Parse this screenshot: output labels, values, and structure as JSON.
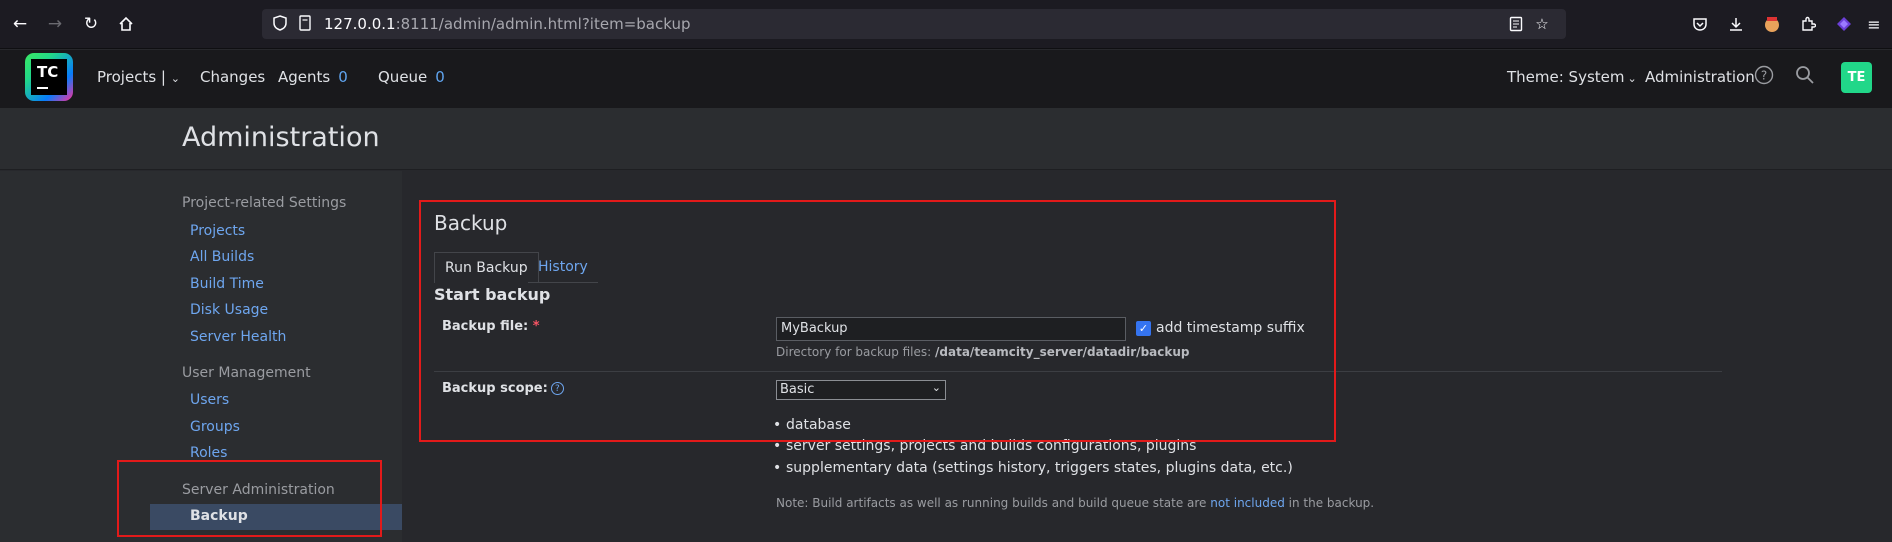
{
  "browser": {
    "url_host": "127.0.0.1",
    "url_rest": ":8111/admin/admin.html?item=backup"
  },
  "header": {
    "logo_text": "TC",
    "projects": "Projects |",
    "changes": "Changes",
    "agents": "Agents",
    "agents_count": "0",
    "queue": "Queue",
    "queue_count": "0",
    "theme": "Theme: System",
    "administration": "Administration",
    "avatar": "TE"
  },
  "page": {
    "title": "Administration"
  },
  "sidebar": {
    "groups": [
      {
        "label": "Project-related Settings"
      },
      {
        "label": "User Management"
      },
      {
        "label": "Server Administration"
      }
    ],
    "items": [
      {
        "label": "Projects"
      },
      {
        "label": "All Builds"
      },
      {
        "label": "Build Time"
      },
      {
        "label": "Disk Usage"
      },
      {
        "label": "Server Health"
      },
      {
        "label": "Users"
      },
      {
        "label": "Groups"
      },
      {
        "label": "Roles"
      },
      {
        "label": "Backup"
      }
    ]
  },
  "main": {
    "section_title": "Backup",
    "tabs": [
      {
        "label": "Run Backup"
      },
      {
        "label": "History"
      }
    ],
    "heading": "Start backup",
    "backup_file_label": "Backup file:",
    "required_mark": "*",
    "backup_file_value": "MyBackup",
    "timestamp_label": "add timestamp suffix",
    "directory_hint": "Directory for backup files:",
    "directory_path": "/data/teamcity_server/datadir/backup",
    "scope_label": "Backup scope:",
    "scope_value": "Basic",
    "scope_items": [
      "database",
      "server settings, projects and builds configurations, plugins",
      "supplementary data (settings history, triggers states, plugins data, etc.)"
    ],
    "note_prefix": "Note: Build artifacts as well as running builds and build queue state are",
    "note_link": "not included",
    "note_suffix": "in the backup."
  },
  "colors": {
    "accent_link": "#6ea6ef",
    "highlight": "#e21a1a",
    "checkbox": "#3574f0"
  }
}
